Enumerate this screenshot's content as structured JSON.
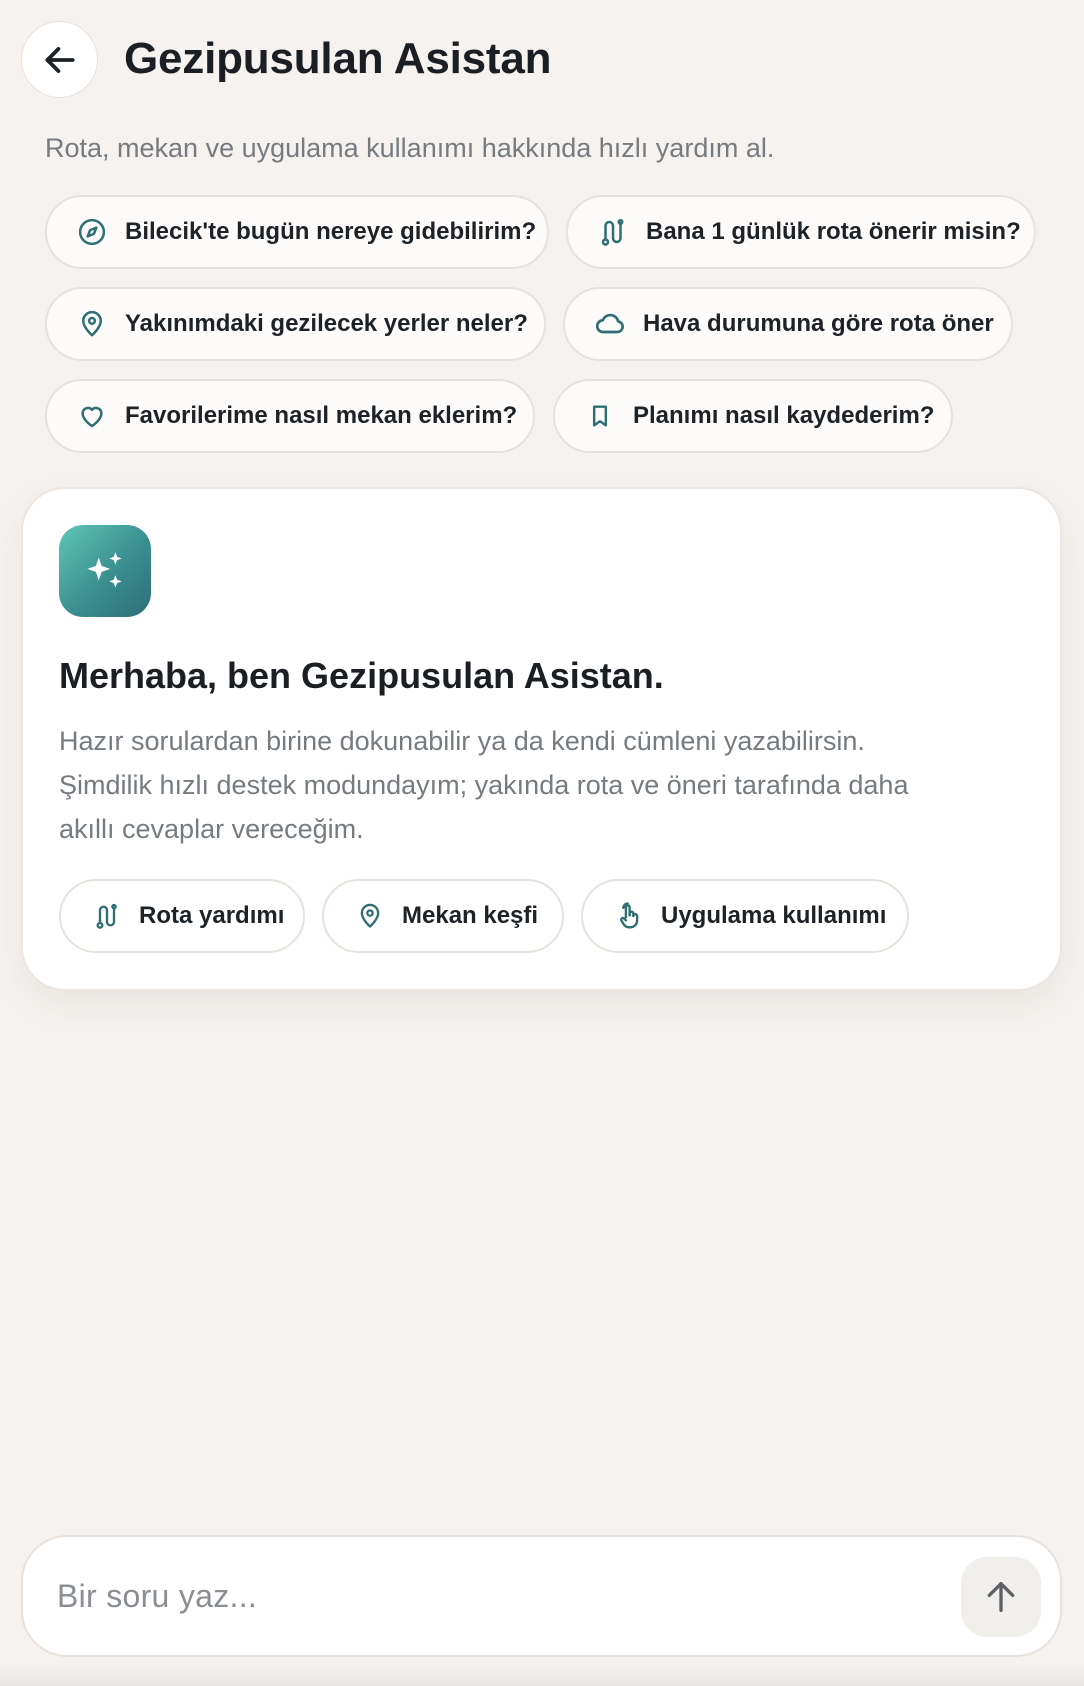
{
  "header": {
    "title": "Gezipusulan Asistan",
    "subtitle": "Rota, mekan ve uygulama kullanımı hakkında hızlı yardım al.",
    "back_icon": "arrow-left-icon"
  },
  "suggestions": [
    {
      "label": "Bilecik'te bugün nereye gidebilirim?",
      "icon": "compass-icon"
    },
    {
      "label": "Bana 1 günlük rota önerir misin?",
      "icon": "route-icon"
    },
    {
      "label": "Yakınımdaki gezilecek yerler neler?",
      "icon": "map-pin-icon"
    },
    {
      "label": "Hava durumuna göre rota öner",
      "icon": "cloud-icon"
    },
    {
      "label": "Favorilerime nasıl mekan eklerim?",
      "icon": "heart-icon"
    },
    {
      "label": "Planımı nasıl kaydederim?",
      "icon": "bookmark-icon"
    }
  ],
  "welcome": {
    "icon": "sparkles-icon",
    "title": "Merhaba, ben Gezipusulan Asistan.",
    "lines": [
      "Hazır sorulardan birine dokunabilir ya da kendi cümleni yazabilirsin.",
      "Şimdilik hızlı destek modundayım; yakında rota ve öneri tarafında daha",
      "akıllı cevaplar vereceğim."
    ],
    "tags": [
      {
        "label": "Rota yardımı",
        "icon": "route-icon"
      },
      {
        "label": "Mekan keşfi",
        "icon": "map-pin-icon"
      },
      {
        "label": "Uygulama kullanımı",
        "icon": "hand-pointer-icon"
      }
    ]
  },
  "composer": {
    "placeholder": "Bir soru yaz...",
    "value": "",
    "send_icon": "arrow-up-icon"
  },
  "colors": {
    "background": "#f5f2ef",
    "accent": "#2f6f73",
    "card": "#ffffff",
    "muted_text": "#767b80"
  }
}
